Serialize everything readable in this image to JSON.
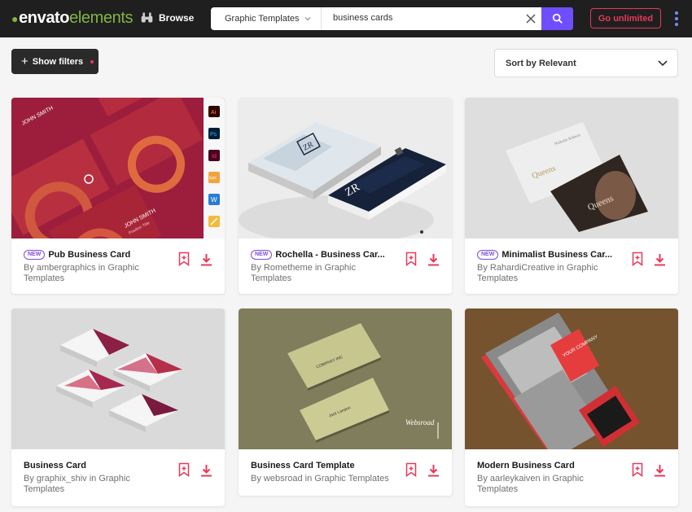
{
  "header": {
    "logo_part1": "envato",
    "logo_part2": "elements",
    "browse_label": "Browse",
    "category_label": "Graphic Templates",
    "search_value": "business cards",
    "cta_label": "Go unlimited"
  },
  "controls": {
    "filters_label": "Show filters",
    "sort_label": "Sort by Relevant"
  },
  "badge_text": "NEW",
  "colors": {
    "accent": "#e8385a",
    "search": "#6e4eff",
    "new_badge": "#7c4ddd",
    "brand_green": "#82b541"
  },
  "cards": [
    {
      "title": "Pub Business Card",
      "author": "By ambergraphics in Graphic Templates",
      "is_new": true
    },
    {
      "title": "Rochella - Business Car...",
      "author": "By Rometheme in Graphic Templates",
      "is_new": true
    },
    {
      "title": "Minimalist Business Car...",
      "author": "By RahardiCreative in Graphic Templates",
      "is_new": true
    },
    {
      "title": "Business Card",
      "author": "By graphix_shiv in Graphic Templates",
      "is_new": false
    },
    {
      "title": "Business Card Template",
      "author": "By websroad in Graphic Templates",
      "is_new": false
    },
    {
      "title": "Modern Business Card",
      "author": "By aarleykaiven in Graphic Templates",
      "is_new": false
    }
  ],
  "thumb_text": {
    "card1_name": "JOHN SMITH",
    "card1_role": "Position Title",
    "card1_apps": [
      "Ai",
      "Ps",
      "Id",
      "Eps",
      "W",
      ""
    ],
    "card2_logo": "ZR",
    "card3_logo": "Queens",
    "card3_name": "Nathalie Roberts",
    "card5_company": "COMPANY INC",
    "card5_name": "Jack Landon",
    "card5_brand": "Websroad",
    "card6_company": "YOUR COMPANY"
  }
}
